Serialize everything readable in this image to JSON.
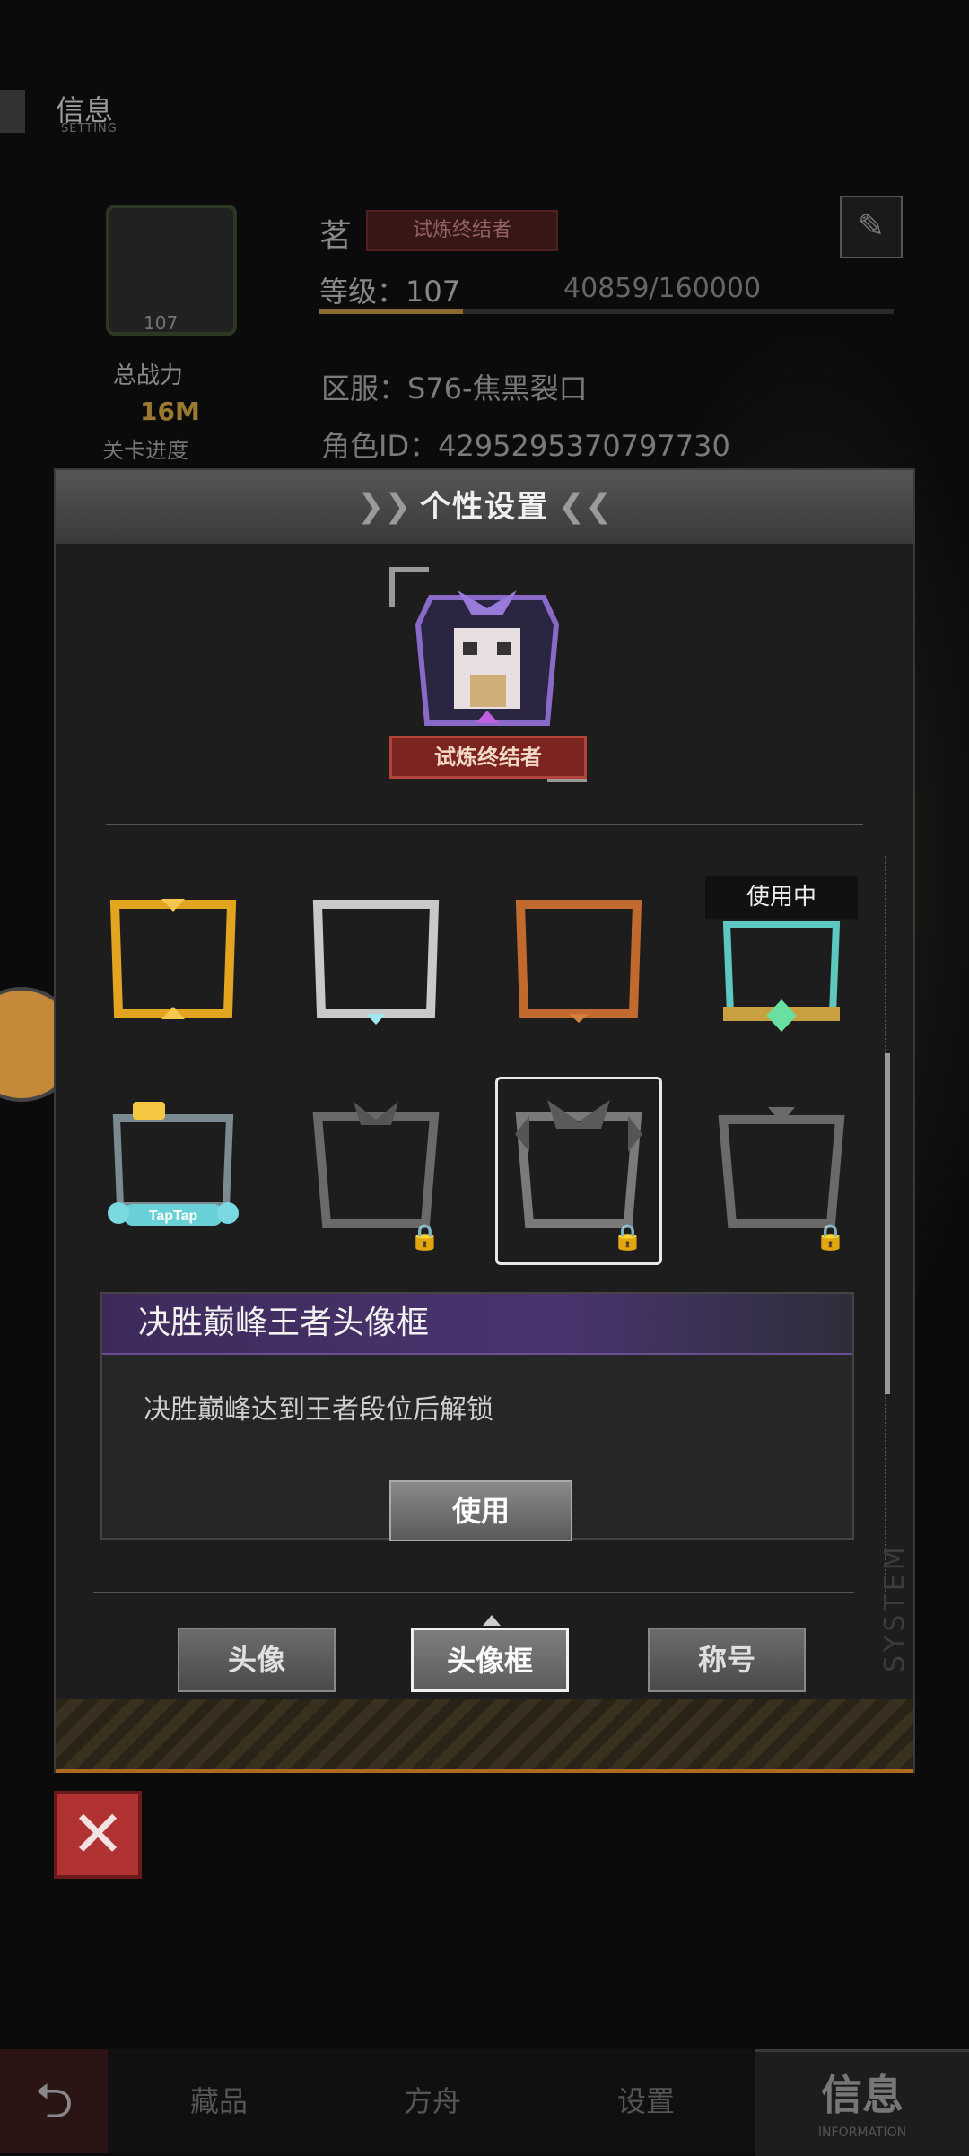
{
  "header": {
    "title": "信息",
    "subtitle": "SETTING"
  },
  "profile": {
    "name": "茗",
    "title_badge": "试炼终结者",
    "level_text": "等级：107",
    "exp_text": "40859/160000",
    "exp_fraction": 0.25,
    "server_text": "区服：S76-焦黑裂口",
    "role_id_text": "角色ID：4295295370797730",
    "avatar_level": "107",
    "power_label": "总战力",
    "power_value": "16M",
    "stage_label": "关卡进度"
  },
  "dialog": {
    "title": "个性设置",
    "preview_badge": "试炼终结者",
    "in_use_tag": "使用中",
    "frames": [
      {
        "name": "gold-frame",
        "locked": false,
        "color": "#e3a520"
      },
      {
        "name": "silver-frame",
        "locked": false,
        "color": "#c9c9c9"
      },
      {
        "name": "bronze-frame",
        "locked": false,
        "color": "#c06a30"
      },
      {
        "name": "jade-gold-frame",
        "locked": false,
        "color": "#5ec8c0"
      },
      {
        "name": "taptap-frame",
        "locked": false,
        "color": "#6ad0d8",
        "label": "TapTap"
      },
      {
        "name": "dragon-frame",
        "locked": true,
        "color": "#6a6a6a"
      },
      {
        "name": "king-frame",
        "locked": true,
        "color": "#7a7a7a"
      },
      {
        "name": "spike-frame",
        "locked": true,
        "color": "#6a6a6a"
      }
    ],
    "selected": {
      "name": "决胜巅峰王者头像框",
      "description": "决胜巅峰达到王者段位后解锁",
      "use_label": "使用"
    },
    "tabs": [
      {
        "label": "头像",
        "active": false
      },
      {
        "label": "头像框",
        "active": true
      },
      {
        "label": "称号",
        "active": false
      }
    ],
    "side_text": "SYSTEM"
  },
  "bottom_nav": {
    "items": [
      "藏品",
      "方舟",
      "设置"
    ],
    "active": "信息",
    "active_sub": "INFORMATION"
  }
}
